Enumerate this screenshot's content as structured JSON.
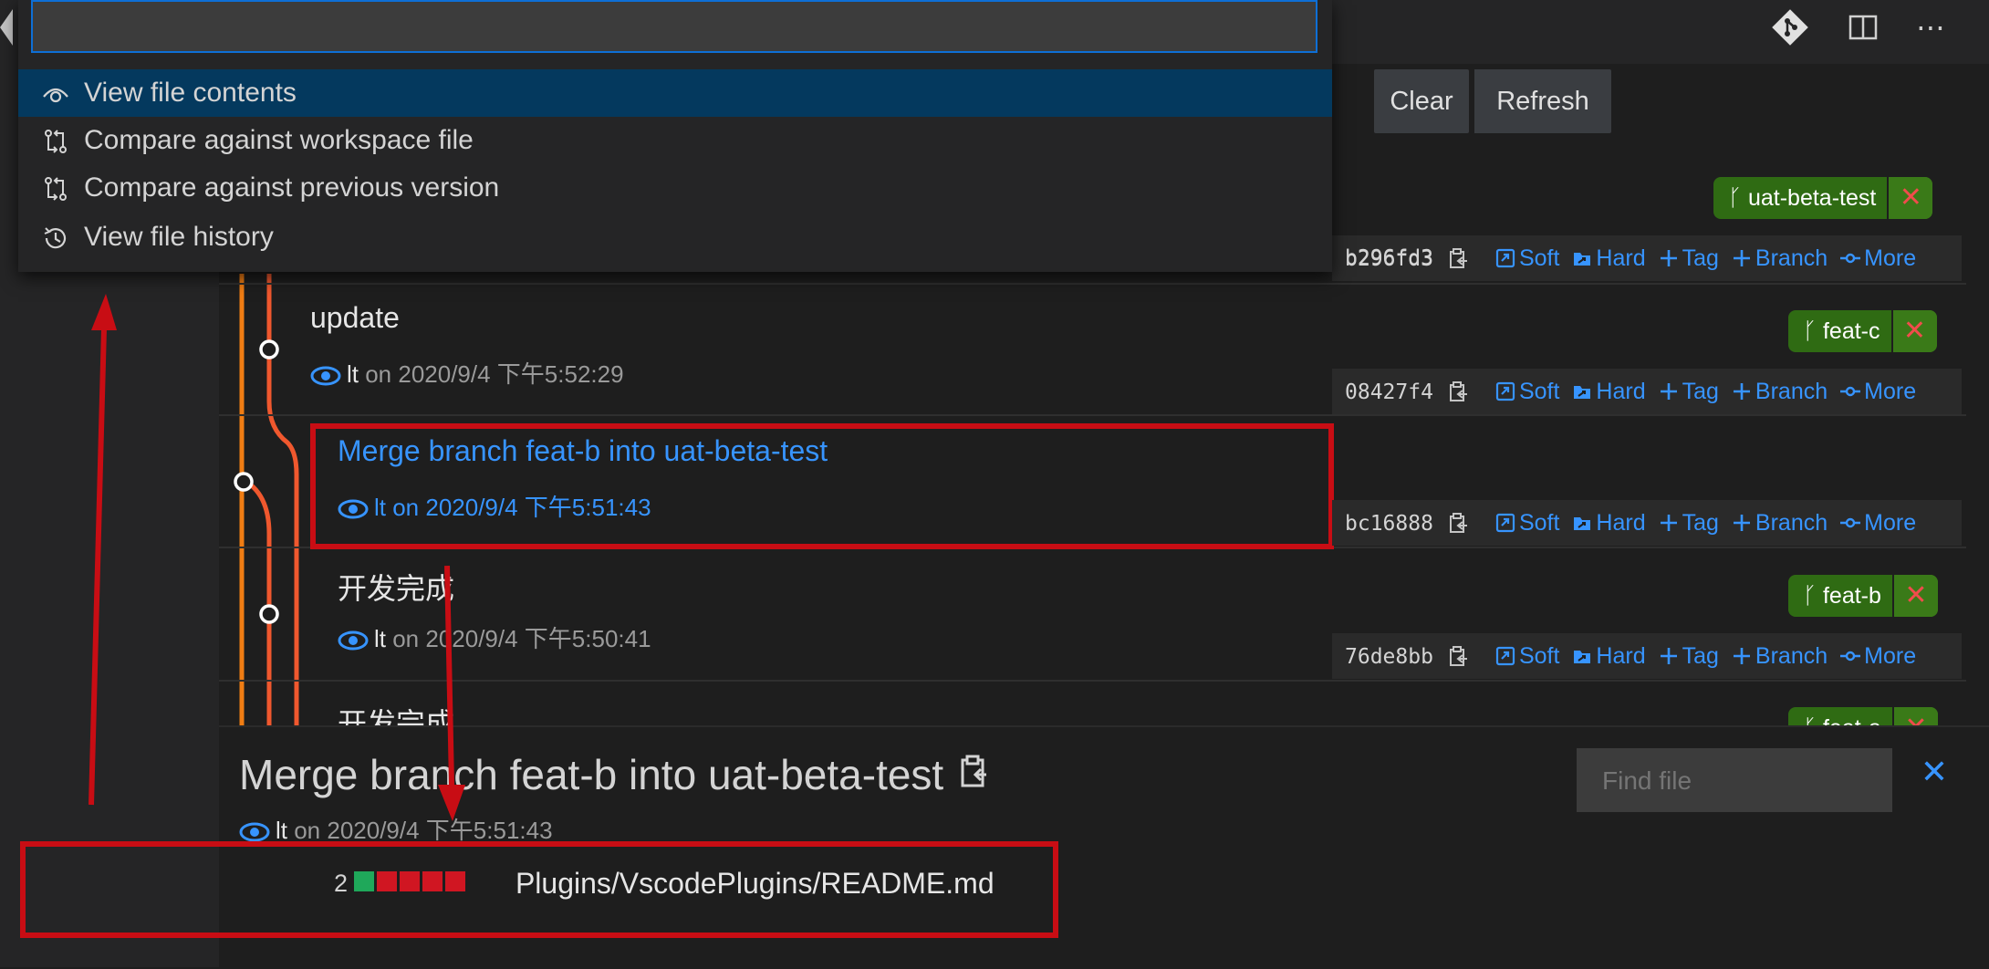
{
  "dropdown": {
    "input_value": "",
    "items": [
      {
        "label": "View file contents",
        "icon": "eye-icon"
      },
      {
        "label": "Compare against workspace file",
        "icon": "compare-icon"
      },
      {
        "label": "Compare against previous version",
        "icon": "compare-icon"
      },
      {
        "label": "View file history",
        "icon": "history-icon"
      }
    ]
  },
  "toolbar": {
    "clear_label": "Clear",
    "refresh_label": "Refresh"
  },
  "actions": {
    "soft": "Soft",
    "hard": "Hard",
    "tag": "Tag",
    "branch": "Branch",
    "more": "More"
  },
  "commits": [
    {
      "title": "",
      "author": "",
      "date": "",
      "hash": "b296fd3",
      "branch": "uat-beta-test"
    },
    {
      "title": "update",
      "author": "lt",
      "date": " on 2020/9/4 下午5:52:29",
      "hash": "08427f4",
      "branch": "feat-c"
    },
    {
      "title": "Merge branch feat-b into uat-beta-test",
      "author": "lt",
      "date": " on 2020/9/4 下午5:51:43",
      "hash": "bc16888",
      "branch": ""
    },
    {
      "title": "开发完成",
      "author": "lt",
      "date": " on 2020/9/4 下午5:50:41",
      "hash": "76de8bb",
      "branch": "feat-b"
    },
    {
      "title": "开发完成",
      "author": "",
      "date": "",
      "hash": "",
      "branch": "feat-a"
    }
  ],
  "details": {
    "title": "Merge branch feat-b into uat-beta-test",
    "author": "lt",
    "date": " on 2020/9/4 下午5:51:43",
    "find_placeholder": "Find file",
    "file": {
      "changes": "2",
      "path": "Plugins/VscodePlugins/README.md",
      "added": 1,
      "removed": 4
    }
  },
  "colors": {
    "accent": "#3794ff",
    "branch_tag": "#2f6b13",
    "highlight": "#c80d14",
    "selection": "#04395e"
  }
}
